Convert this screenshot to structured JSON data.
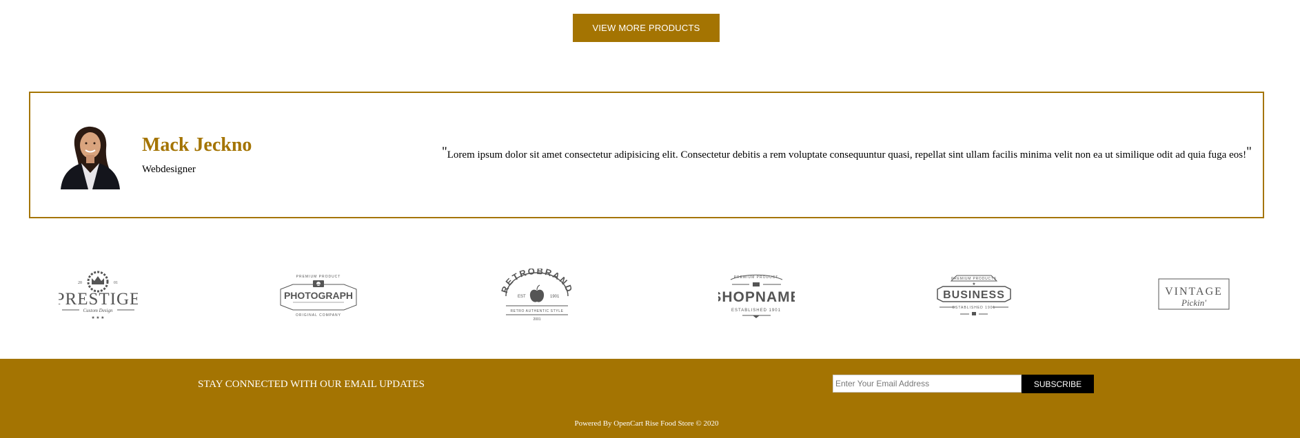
{
  "products": {
    "view_more_label": "VIEW MORE PRODUCTS"
  },
  "testimonial": {
    "name": "Mack Jeckno",
    "role": "Webdesigner",
    "quote_open": "\"",
    "quote": "Lorem ipsum dolor sit amet consectetur adipisicing elit. Consectetur debitis a rem voluptate consequuntur quasi, repellat sint ullam facilis minima velit non ea ut similique odit ad quia fuga eos!",
    "quote_close": "\"",
    "accent_color": "#a47402"
  },
  "brands": [
    {
      "name": "PRESTIGE",
      "tagline": "Custom Design",
      "icon": "crown-icon"
    },
    {
      "name": "PHOTOGRAPH",
      "tagline": "ORIGINAL COMPANY",
      "top": "PREMIUM PRODUCT",
      "icon": "camera-icon"
    },
    {
      "name": "RETROBRAND",
      "tagline": "RETRO AUTHENTIC STYLE",
      "icon": "apple-icon"
    },
    {
      "name": "SHOPNAME",
      "tagline": "ESTABLISHED 1901",
      "top": "PREMIUM PRODUCT",
      "icon": "star-icon"
    },
    {
      "name": "BUSINESS",
      "tagline": "ESTABLISHED 1901",
      "top": "PREMIUM PRODUCTS",
      "icon": "star-icon"
    },
    {
      "name": "VINTAGE",
      "tagline": "Pickin'",
      "icon": "frame-icon"
    }
  ],
  "footer": {
    "newsletter_text": "STAY CONNECTED WITH OUR EMAIL UPDATES",
    "email_placeholder": "Enter Your Email Address",
    "subscribe_label": "SUBSCRIBE",
    "powered_by": "Powered By OpenCart Rise Food Store © 2020",
    "background_color": "#a47402"
  }
}
